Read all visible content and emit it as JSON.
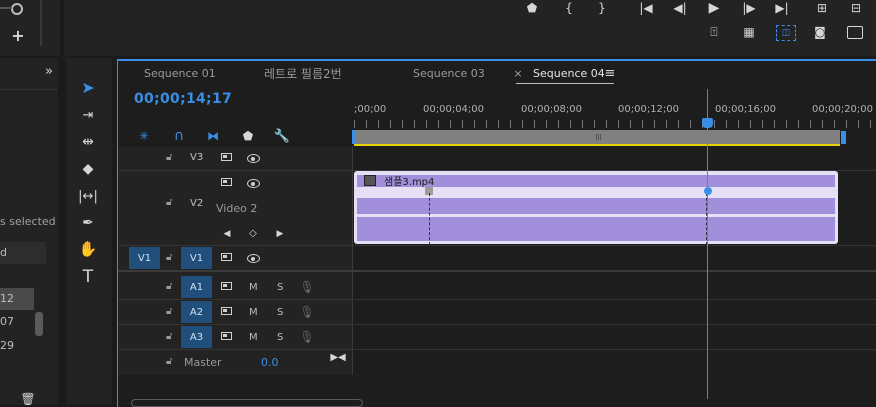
{
  "left_panel": {
    "selected_text": "s selected",
    "col_header": "d",
    "rows": [
      "12",
      "07",
      "29"
    ]
  },
  "tools": [
    "selection-tool",
    "track-select-tool",
    "ripple-edit-tool",
    "razor-tool",
    "slip-tool",
    "pen-tool",
    "hand-tool",
    "type-tool"
  ],
  "tabs": [
    {
      "label": "Sequence 01"
    },
    {
      "label": "레트로 필름2번"
    },
    {
      "label": "Sequence 03"
    },
    {
      "label": "Sequence 04",
      "active": true
    }
  ],
  "timecode": "00;00;14;17",
  "ruler_labels": [
    ";00;00",
    "00;00;04;00",
    "00;00;08;00",
    "00;00;12;00",
    "00;00;16;00",
    "00;00;20;00"
  ],
  "tracks": {
    "v3": {
      "label": "V3"
    },
    "v2": {
      "label": "V2",
      "name": "Video 2"
    },
    "v1": {
      "source": "V1",
      "label": "V1"
    },
    "a1": {
      "label": "A1",
      "m": "M",
      "s": "S"
    },
    "a2": {
      "label": "A2",
      "m": "M",
      "s": "S"
    },
    "a3": {
      "label": "A3",
      "m": "M",
      "s": "S"
    },
    "master": {
      "label": "Master",
      "value": "0.0"
    }
  },
  "clip": {
    "name": "샘플3.mp4",
    "color": "#a28fdc"
  },
  "colors": {
    "accent": "#3a8ee6",
    "timecode": "#3a8ee6",
    "track_button": "#1f4f7a"
  }
}
